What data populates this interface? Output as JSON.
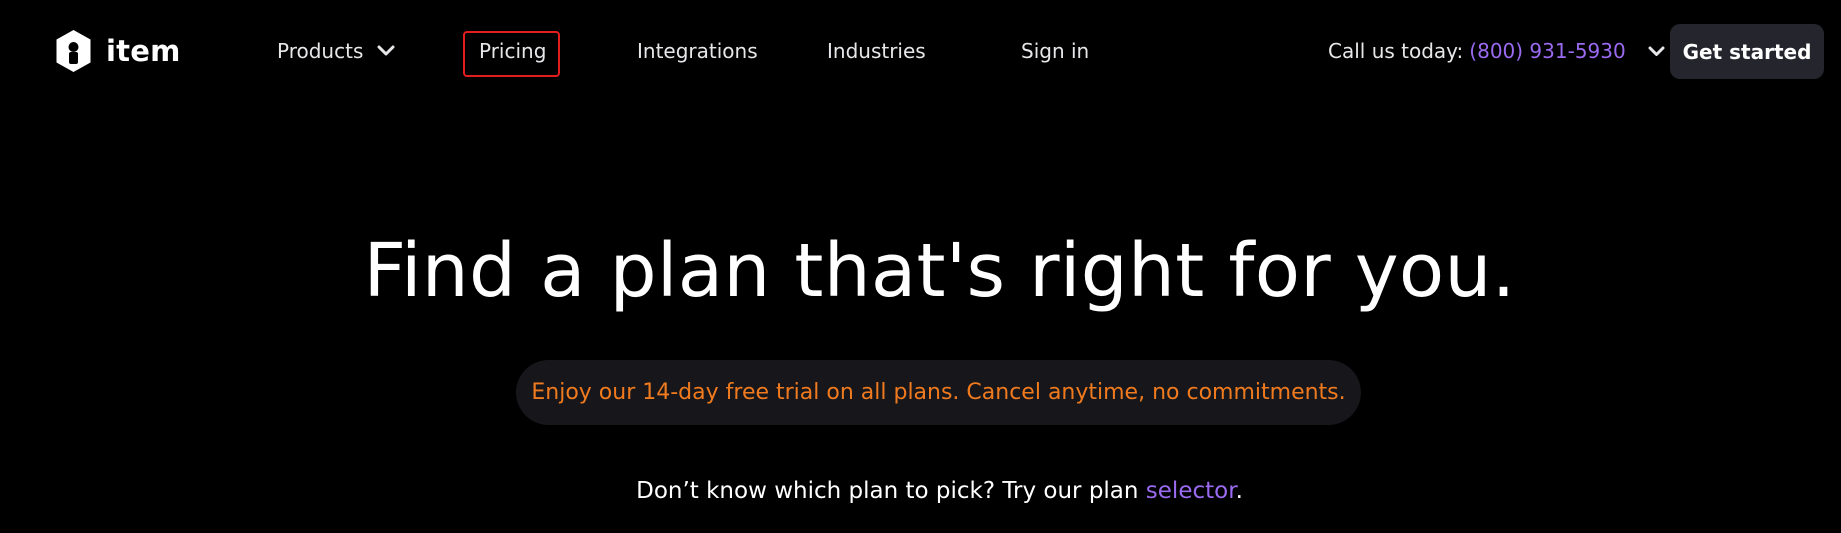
{
  "brand": {
    "name": "item"
  },
  "nav": {
    "products": "Products",
    "pricing": "Pricing",
    "integrations": "Integrations",
    "industries": "Industries",
    "signin": "Sign in"
  },
  "contact": {
    "label": "Call us today:",
    "phone": "(800) 931-5930"
  },
  "cta": {
    "label": "Get started"
  },
  "hero": {
    "title": "Find a plan that's right for you.",
    "trial": "Enjoy our 14-day free trial on all plans. Cancel anytime, no commitments.",
    "sub_prefix": "Don’t know which plan to pick? Try our plan",
    "sub_link": "selector",
    "sub_suffix": "."
  },
  "colors": {
    "background": "#000000",
    "accent_purple": "#9a6af0",
    "trial_orange": "#f07a1e",
    "cta_bg": "#25252e",
    "highlight_red": "#e11d1d"
  },
  "icons": [
    "item-logo-icon",
    "chevron-down-icon"
  ]
}
